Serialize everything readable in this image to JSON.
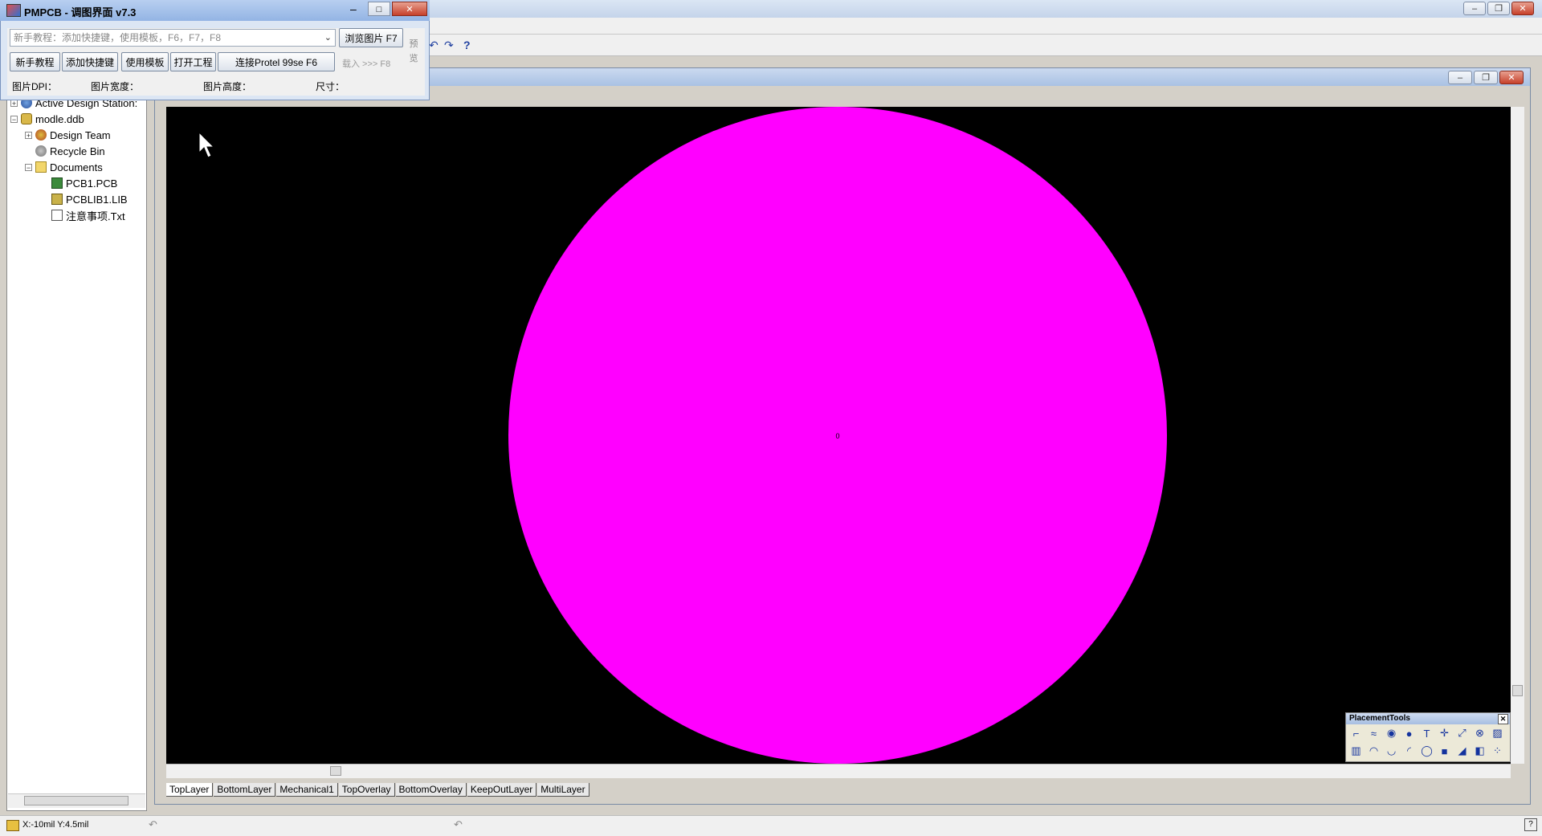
{
  "pmpcb": {
    "title": "PMPCB - 调图界面 v7.3",
    "combo_placeholder": "新手教程：添加快捷键，使用模板，F6，F7，F8",
    "browse_button": "浏览图片 F7",
    "preview_label": "预览",
    "buttons": [
      "新手教程",
      "添加快捷键",
      "使用模板",
      "打开工程",
      "连接Protel 99se   F6"
    ],
    "load_label": "载入 >>> F8",
    "info": {
      "dpi": "图片DPI：",
      "width": "图片宽度：",
      "height": "图片高度：",
      "size": "尺寸："
    }
  },
  "tree": {
    "items": [
      {
        "label": "Active Design Station:",
        "depth": 0
      },
      {
        "label": "modle.ddb",
        "depth": 0
      },
      {
        "label": "Design Team",
        "depth": 1
      },
      {
        "label": "Recycle Bin",
        "depth": 1
      },
      {
        "label": "Documents",
        "depth": 1
      },
      {
        "label": "PCB1.PCB",
        "depth": 2
      },
      {
        "label": "PCBLIB1.LIB",
        "depth": 2
      },
      {
        "label": "注意事项.Txt",
        "depth": 2
      }
    ]
  },
  "canvas": {
    "circle_color": "#ff00ff",
    "background_color": "#000000",
    "center_label": "0"
  },
  "layer_tabs": [
    "TopLayer",
    "BottomLayer",
    "Mechanical1",
    "TopOverlay",
    "BottomOverlay",
    "KeepOutLayer",
    "MultiLayer"
  ],
  "placement_tools": {
    "title": "PlacementTools"
  },
  "status": {
    "coords": "X:-10mil Y:4.5mil"
  },
  "icons": {
    "help": "?",
    "undo": "↶",
    "redo": "↷"
  }
}
